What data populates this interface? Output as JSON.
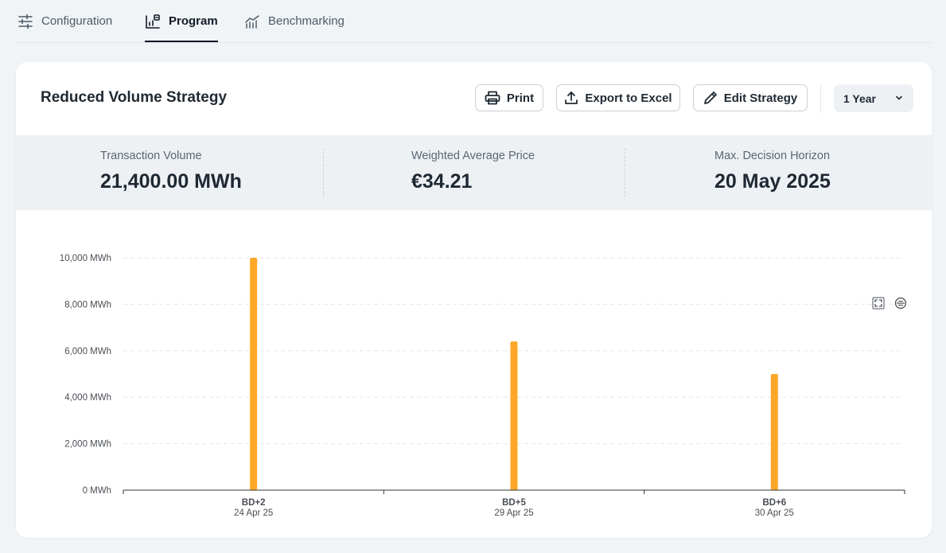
{
  "tabs": [
    {
      "label": "Configuration",
      "active": false,
      "icon": "sliders-icon"
    },
    {
      "label": "Program",
      "active": true,
      "icon": "program-chart-icon"
    },
    {
      "label": "Benchmarking",
      "active": false,
      "icon": "trend-chart-icon"
    }
  ],
  "card": {
    "title": "Reduced Volume Strategy",
    "buttons": {
      "print": "Print",
      "export": "Export to Excel",
      "edit": "Edit Strategy"
    },
    "period_select": "1 Year"
  },
  "stats": [
    {
      "label": "Transaction Volume",
      "value": "21,400.00 MWh"
    },
    {
      "label": "Weighted Average Price",
      "value": "€34.21"
    },
    {
      "label": "Max. Decision Horizon",
      "value": "20 May 2025"
    }
  ],
  "chart_data": {
    "type": "bar",
    "categories": [
      "BD+2",
      "BD+5",
      "BD+6"
    ],
    "sublabels": [
      "24 Apr 25",
      "29 Apr 25",
      "30 Apr 25"
    ],
    "values": [
      10000,
      6400,
      5000
    ],
    "ylim": [
      0,
      10000
    ],
    "yticks": [
      "0 MWh",
      "2,000 MWh",
      "4,000 MWh",
      "6,000 MWh",
      "8,000 MWh",
      "10,000 MWh"
    ],
    "ytick_values": [
      0,
      2000,
      4000,
      6000,
      8000,
      10000
    ],
    "bar_color": "#ffa828",
    "grid": true
  },
  "colors": {
    "accent": "#ffa828",
    "text": "#1f2933"
  }
}
